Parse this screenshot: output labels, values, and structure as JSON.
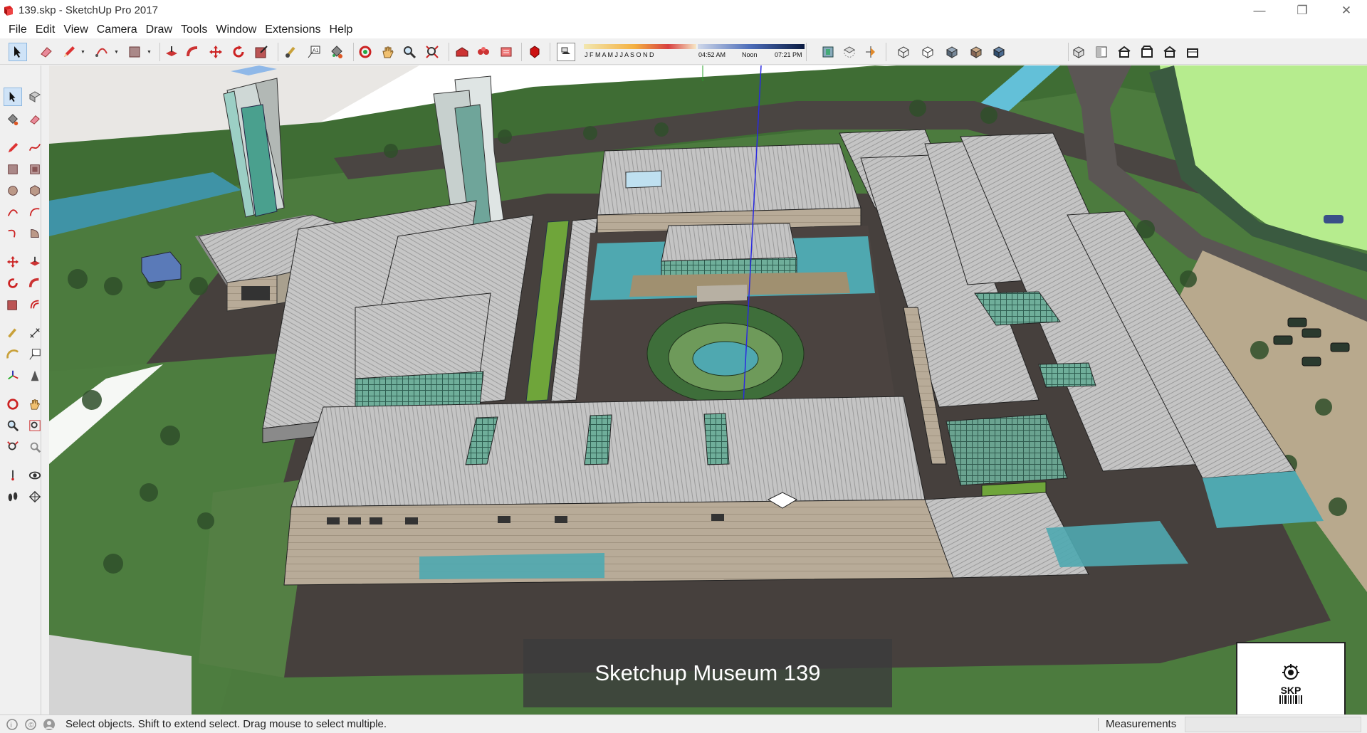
{
  "window": {
    "title": "139.skp - SketchUp Pro 2017",
    "controls": {
      "minimize": "—",
      "restore": "❐",
      "close": "✕"
    }
  },
  "menu": [
    "File",
    "Edit",
    "View",
    "Camera",
    "Draw",
    "Tools",
    "Window",
    "Extensions",
    "Help"
  ],
  "shadow": {
    "months": "J F M A M J J A S O N D",
    "sunrise": "04:52 AM",
    "noon": "Noon",
    "sunset": "07:21 PM"
  },
  "viewport": {
    "caption": "Sketchup Museum 139",
    "logo_text": "SKP"
  },
  "status": {
    "hint": "Select objects. Shift to extend select. Drag mouse to select multiple.",
    "measurements_label": "Measurements",
    "measurements_value": ""
  },
  "icons": {
    "toolbar": [
      "select-icon",
      "eraser-icon",
      "pencil-icon",
      "lasso-icon",
      "paint-bucket-icon",
      "push-pull-icon",
      "follow-me-icon",
      "move-icon",
      "rotate-icon",
      "scale-icon",
      "tape-measure-icon",
      "text-icon",
      "orbit-icon",
      "pan-icon",
      "zoom-icon",
      "zoom-extents-icon",
      "warehouse-icon",
      "extension-icon",
      "layout-icon",
      "ruby-icon",
      "shadows-icon",
      "x-ray-icon",
      "back-edges-icon",
      "wireframe-icon",
      "hidden-line-icon",
      "shaded-icon",
      "shaded-textures-icon",
      "monochrome-icon",
      "iso-view-icon",
      "top-view-icon",
      "front-view-icon",
      "right-view-icon",
      "back-view-icon",
      "left-view-icon"
    ],
    "colors": {
      "grass": "#4a7a3a",
      "roof": "#b8b8b8",
      "water": "#4fa8b0",
      "road": "#4a4542",
      "sky": "#ffffff"
    }
  }
}
